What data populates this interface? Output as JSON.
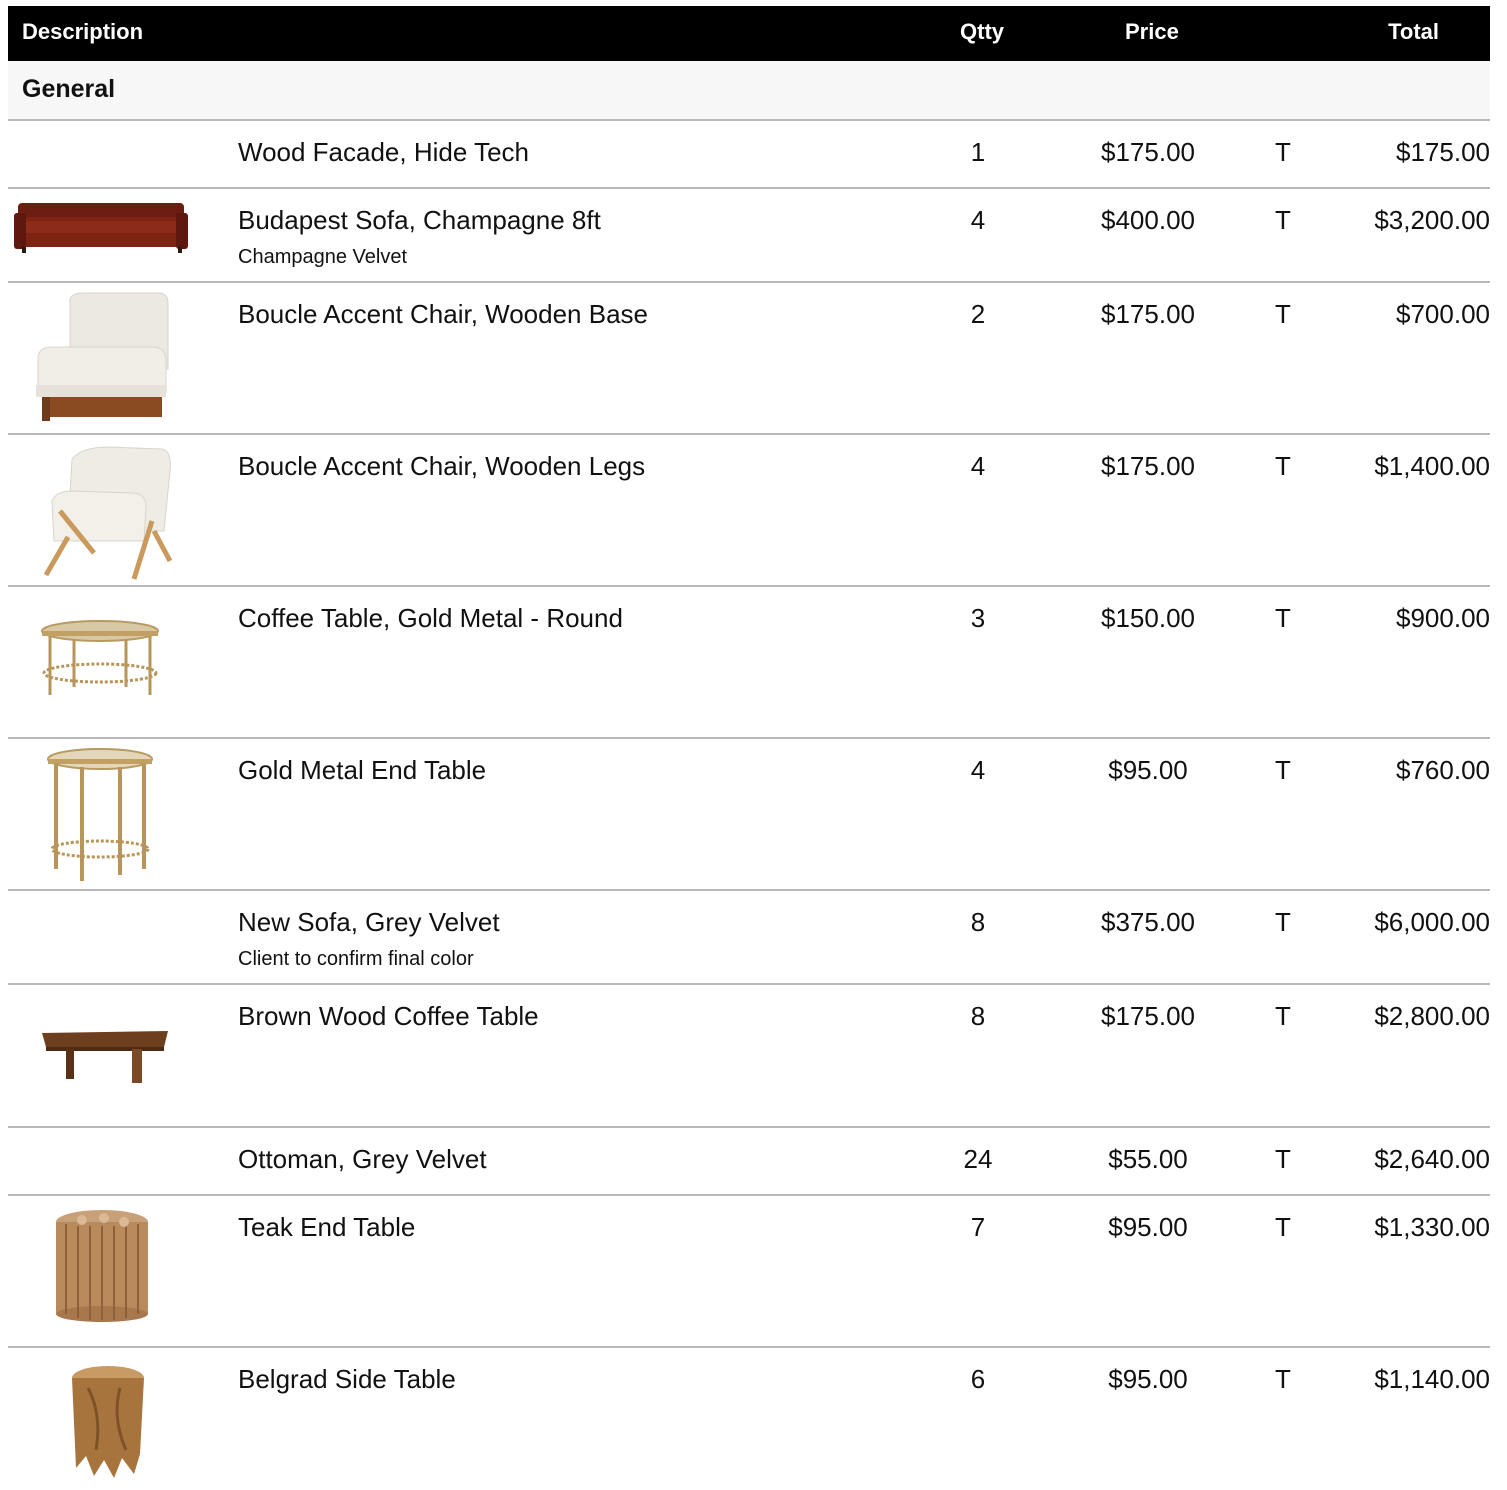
{
  "table": {
    "headers": {
      "description": "Description",
      "qty": "Qtty",
      "price": "Price",
      "total": "Total"
    },
    "section": "General",
    "rows": [
      {
        "name": "Wood Facade, Hide Tech",
        "note": "",
        "qty": "1",
        "price": "$175.00",
        "tax": "T",
        "total": "$175.00",
        "image": ""
      },
      {
        "name": "Budapest Sofa, Champagne 8ft",
        "note": "Champagne Velvet",
        "qty": "4",
        "price": "$400.00",
        "tax": "T",
        "total": "$3,200.00",
        "image": "rust-velvet-sofa-icon"
      },
      {
        "name": "Boucle Accent Chair, Wooden Base",
        "note": "",
        "qty": "2",
        "price": "$175.00",
        "tax": "T",
        "total": "$700.00",
        "image": "boucle-chair-wood-base-icon"
      },
      {
        "name": "Boucle Accent Chair, Wooden Legs",
        "note": "",
        "qty": "4",
        "price": "$175.00",
        "tax": "T",
        "total": "$1,400.00",
        "image": "boucle-chair-wood-legs-icon"
      },
      {
        "name": "Coffee Table, Gold Metal - Round",
        "note": "",
        "qty": "3",
        "price": "$150.00",
        "tax": "T",
        "total": "$900.00",
        "image": "gold-round-coffee-table-icon"
      },
      {
        "name": "Gold Metal End Table",
        "note": "",
        "qty": "4",
        "price": "$95.00",
        "tax": "T",
        "total": "$760.00",
        "image": "gold-end-table-icon"
      },
      {
        "name": "New Sofa, Grey Velvet",
        "note": "Client to confirm final color",
        "qty": "8",
        "price": "$375.00",
        "tax": "T",
        "total": "$6,000.00",
        "image": ""
      },
      {
        "name": "Brown Wood Coffee Table",
        "note": "",
        "qty": "8",
        "price": "$175.00",
        "tax": "T",
        "total": "$2,800.00",
        "image": "brown-wood-coffee-table-icon"
      },
      {
        "name": "Ottoman, Grey Velvet",
        "note": "",
        "qty": "24",
        "price": "$55.00",
        "tax": "T",
        "total": "$2,640.00",
        "image": ""
      },
      {
        "name": "Teak End Table",
        "note": "",
        "qty": "7",
        "price": "$95.00",
        "tax": "T",
        "total": "$1,330.00",
        "image": "teak-log-end-table-icon"
      },
      {
        "name": "Belgrad Side Table",
        "note": "",
        "qty": "6",
        "price": "$95.00",
        "tax": "T",
        "total": "$1,140.00",
        "image": "teak-stump-side-table-icon"
      }
    ]
  }
}
